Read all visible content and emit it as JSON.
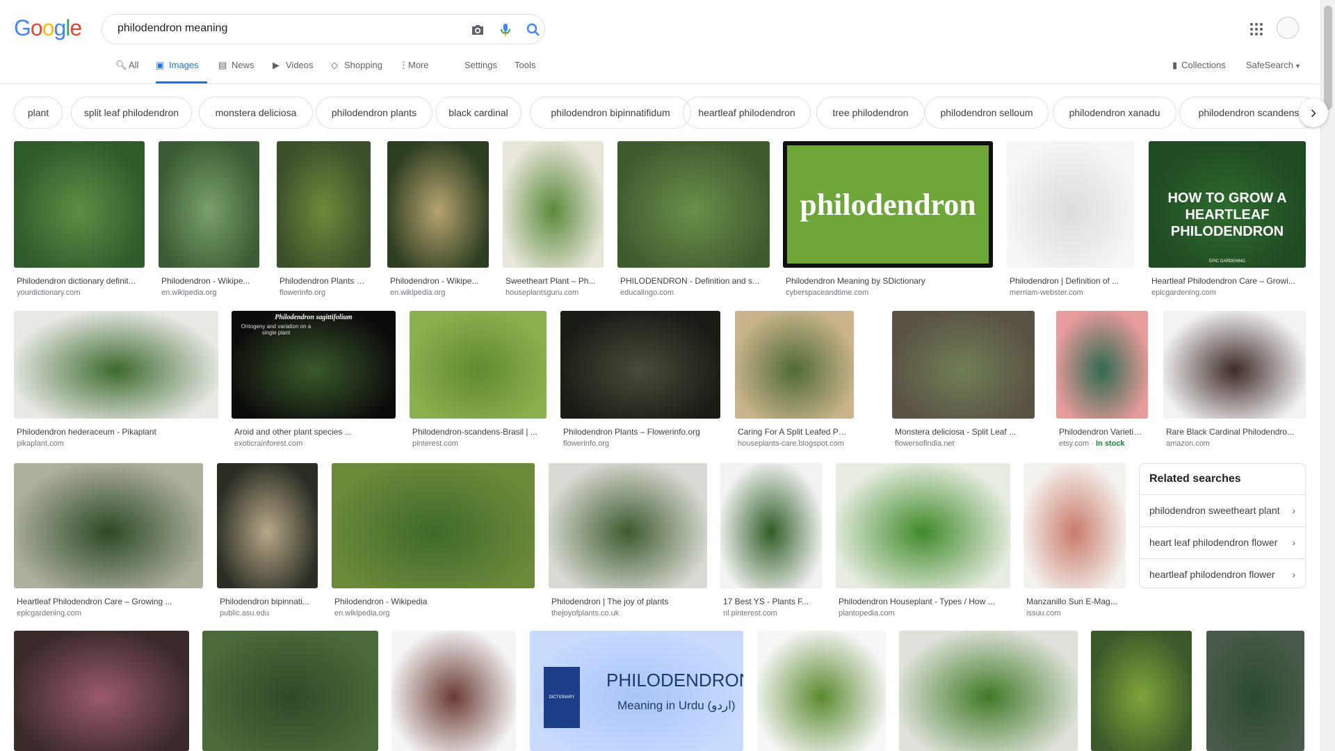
{
  "search": {
    "query": "philodendron meaning"
  },
  "logo": {
    "text": "Google"
  },
  "tabs": [
    {
      "label": "All",
      "icon": "search-icon"
    },
    {
      "label": "Images",
      "icon": "image-icon"
    },
    {
      "label": "News",
      "icon": "news-icon"
    },
    {
      "label": "Videos",
      "icon": "video-icon"
    },
    {
      "label": "Shopping",
      "icon": "tag-icon"
    },
    {
      "label": "More",
      "icon": "more-dots-icon"
    }
  ],
  "tools": {
    "settings": "Settings",
    "tools": "Tools",
    "collections": "Collections",
    "safesearch": "SafeSearch"
  },
  "chips": [
    "plant",
    "split leaf philodendron",
    "monstera deliciosa",
    "philodendron plants",
    "black cardinal",
    "philodendron bipinnatifidum",
    "heartleaf philodendron",
    "tree philodendron",
    "philodendron selloum",
    "philodendron xanadu",
    "philodendron scandens"
  ],
  "results": [
    {
      "title": "Philodendron dictionary definit...",
      "domain": "yourdictionary.com"
    },
    {
      "title": "Philodendron - Wikipe...",
      "domain": "en.wikipedia.org"
    },
    {
      "title": "Philodendron Plants –...",
      "domain": "flowerinfo.org"
    },
    {
      "title": "Philodendron - Wikipe...",
      "domain": "en.wikipedia.org"
    },
    {
      "title": "Sweetheart Plant – Ph...",
      "domain": "houseplantsguru.com"
    },
    {
      "title": "PHILODENDRON - Definition and s...",
      "domain": "educalingo.com"
    },
    {
      "title": "Philodendron Meaning by SDictionary",
      "domain": "cyberspaceandtime.com",
      "overlay": "philodendron"
    },
    {
      "title": "Philodendron | Definition of ...",
      "domain": "merriam-webster.com"
    },
    {
      "title": "Heartleaf Philodendron Care – Growi...",
      "domain": "epicgardening.com",
      "overlay": "HOW TO GROW A HEARTLEAF PHILODENDRON",
      "overlay_small": "EPIC GARDENING"
    },
    {
      "title": "Philodendron hederaceum - Pikaplant",
      "domain": "pikaplant.com"
    },
    {
      "title": "Aroid and other plant species ...",
      "domain": "exoticrainforest.com",
      "overlay": "Philodendron sagittifolium",
      "overlay2": "Ontogeny and variation on a single plant"
    },
    {
      "title": "Philodendron-scandens-Brasil | ...",
      "domain": "pinterest.com"
    },
    {
      "title": "Philodendron Plants – Flowerinfo.org",
      "domain": "flowerinfo.org"
    },
    {
      "title": "Caring For A Split Leafed Philode...",
      "domain": "houseplants-care.blogspot.com"
    },
    {
      "title": "Monstera deliciosa - Split Leaf ...",
      "domain": "flowersofindia.net"
    },
    {
      "title": "Philodendron Varieties...",
      "domain": "etsy.com",
      "extra": "In stock"
    },
    {
      "title": "Rare Black Cardinal Philodendro...",
      "domain": "amazon.com"
    },
    {
      "title": "Heartleaf Philodendron Care – Growing ...",
      "domain": "epicgardening.com"
    },
    {
      "title": "Philodendron bipinnati...",
      "domain": "public.asu.edu"
    },
    {
      "title": "Philodendron - Wikipedia",
      "domain": "en.wikipedia.org"
    },
    {
      "title": "Philodendron | The joy of plants",
      "domain": "thejoyofplants.co.uk"
    },
    {
      "title": "17 Best YS - Plants F...",
      "domain": "nl.pinterest.com"
    },
    {
      "title": "Philodendron Houseplant - Types / How ...",
      "domain": "plantopedia.com"
    },
    {
      "title": "Manzanillo Sun E-Mag...",
      "domain": "issuu.com"
    },
    {
      "title": "",
      "domain": ""
    },
    {
      "title": "",
      "domain": ""
    },
    {
      "title": "",
      "domain": ""
    },
    {
      "title": "",
      "domain": "",
      "overlay": "PHILODENDRON",
      "overlay2": "Meaning in Urdu (اردو)",
      "overlay_small": "DICTIONARY"
    },
    {
      "title": "",
      "domain": ""
    },
    {
      "title": "",
      "domain": ""
    },
    {
      "title": "",
      "domain": ""
    },
    {
      "title": "",
      "domain": ""
    }
  ],
  "related": {
    "heading": "Related searches",
    "items": [
      "philodendron sweetheart plant",
      "heart leaf philodendron flower",
      "heartleaf philodendron flower"
    ]
  },
  "colors": {
    "accent": "#1a73e8",
    "caption": "#3c4043",
    "domain": "#70757a",
    "stock": "#188038"
  }
}
